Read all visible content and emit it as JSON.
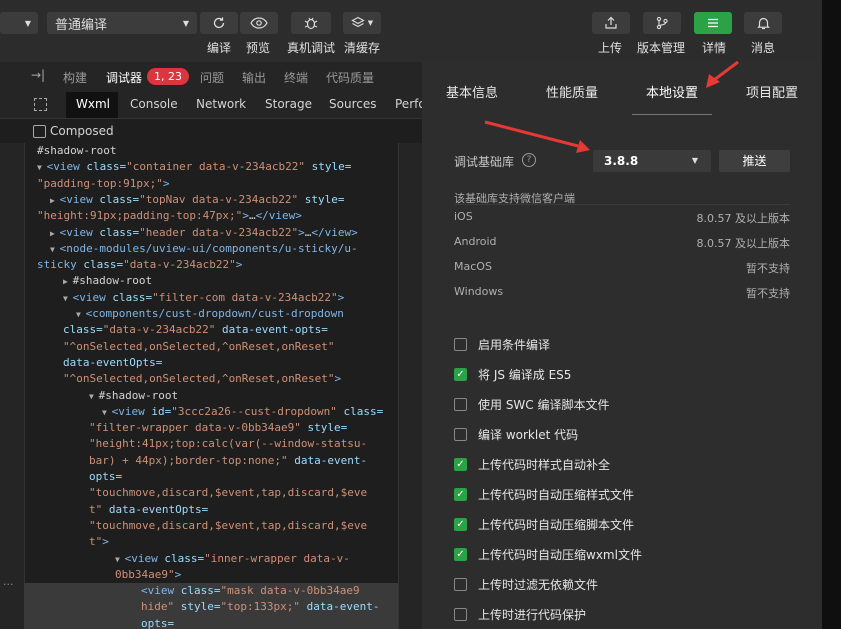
{
  "toolbar": {
    "compile_mode": "普通编译",
    "left_buttons": [
      "编译",
      "预览",
      "真机调试",
      "清缓存"
    ],
    "right_buttons": [
      "上传",
      "版本管理",
      "详情",
      "消息"
    ],
    "accent": "#2ba245"
  },
  "devtools": {
    "top_tabs": [
      "构建",
      "调试器",
      "问题",
      "输出",
      "终端",
      "代码质量"
    ],
    "badge": "1, 23",
    "sub_tabs": [
      "Wxml",
      "Console",
      "Network",
      "Storage",
      "Sources",
      "Perfo"
    ],
    "composed_label": "Composed",
    "dots": "···",
    "code_lines": [
      {
        "indent": 2,
        "tri": "",
        "parts": [
          [
            "tx",
            "#shadow-root"
          ]
        ]
      },
      {
        "indent": 2,
        "tri": "▼",
        "parts": [
          [
            "tg",
            "<view "
          ],
          [
            "at",
            "class="
          ],
          [
            "vl",
            "\"container data-v-234acb22\""
          ],
          [
            "at",
            " style="
          ]
        ]
      },
      {
        "indent": 2,
        "tri": "",
        "parts": [
          [
            "vl",
            "\"padding-top:91px;\""
          ],
          [
            "tg",
            ">"
          ]
        ]
      },
      {
        "indent": 3,
        "tri": "▶",
        "parts": [
          [
            "tg",
            "<view "
          ],
          [
            "at",
            "class="
          ],
          [
            "vl",
            "\"topNav data-v-234acb22\""
          ],
          [
            "at",
            " style="
          ]
        ]
      },
      {
        "indent": 2,
        "tri": "",
        "parts": [
          [
            "vl",
            "\"height:91px;padding-top:47px;\""
          ],
          [
            "tg",
            ">"
          ],
          [
            "tx",
            "…"
          ],
          [
            "tg",
            "</view>"
          ]
        ]
      },
      {
        "indent": 3,
        "tri": "▶",
        "parts": [
          [
            "tg",
            "<view "
          ],
          [
            "at",
            "class="
          ],
          [
            "vl",
            "\"header data-v-234acb22\""
          ],
          [
            "tg",
            ">"
          ],
          [
            "tx",
            "…"
          ],
          [
            "tg",
            "</view>"
          ]
        ]
      },
      {
        "indent": 3,
        "tri": "▼",
        "parts": [
          [
            "tg",
            "<node-modules/uview-ui/components/u-sticky/u-"
          ]
        ]
      },
      {
        "indent": 2,
        "tri": "",
        "parts": [
          [
            "tg",
            "sticky "
          ],
          [
            "at",
            "class="
          ],
          [
            "vl",
            "\"data-v-234acb22\""
          ],
          [
            "tg",
            ">"
          ]
        ]
      },
      {
        "indent": 4,
        "tri": "▶",
        "parts": [
          [
            "tx",
            "#shadow-root"
          ]
        ]
      },
      {
        "indent": 4,
        "tri": "▼",
        "parts": [
          [
            "tg",
            "<view "
          ],
          [
            "at",
            "class="
          ],
          [
            "vl",
            "\"filter-com data-v-234acb22\""
          ],
          [
            "tg",
            ">"
          ]
        ]
      },
      {
        "indent": 5,
        "tri": "▼",
        "parts": [
          [
            "tg",
            "<components/cust-dropdown/cust-dropdown"
          ]
        ]
      },
      {
        "indent": 4,
        "tri": "",
        "parts": [
          [
            "at",
            "class="
          ],
          [
            "vl",
            "\"data-v-234acb22\""
          ],
          [
            "at",
            " data-event-opts="
          ]
        ]
      },
      {
        "indent": 4,
        "tri": "",
        "parts": [
          [
            "vl",
            "\"^onSelected,onSelected,^onReset,onReset\""
          ]
        ]
      },
      {
        "indent": 4,
        "tri": "",
        "parts": [
          [
            "at",
            "data-eventOpts="
          ]
        ]
      },
      {
        "indent": 4,
        "tri": "",
        "parts": [
          [
            "vl",
            "\"^onSelected,onSelected,^onReset,onReset\""
          ],
          [
            "tg",
            ">"
          ]
        ]
      },
      {
        "indent": 6,
        "tri": "▼",
        "parts": [
          [
            "tx",
            "#shadow-root"
          ]
        ]
      },
      {
        "indent": 7,
        "tri": "▼",
        "parts": [
          [
            "tg",
            "<view "
          ],
          [
            "at",
            "id="
          ],
          [
            "vl",
            "\"3ccc2a26--cust-dropdown\""
          ],
          [
            "at",
            " class="
          ]
        ]
      },
      {
        "indent": 6,
        "tri": "",
        "parts": [
          [
            "vl",
            "\"filter-wrapper data-v-0bb34ae9\""
          ],
          [
            "at",
            " style="
          ]
        ]
      },
      {
        "indent": 6,
        "tri": "",
        "parts": [
          [
            "vl",
            "\"height:41px;top:calc(var(--window-statsu-"
          ]
        ]
      },
      {
        "indent": 6,
        "tri": "",
        "parts": [
          [
            "vl",
            "bar) + 44px);border-top:none;\""
          ],
          [
            "at",
            " data-event-"
          ]
        ]
      },
      {
        "indent": 6,
        "tri": "",
        "parts": [
          [
            "at",
            "opts="
          ]
        ]
      },
      {
        "indent": 6,
        "tri": "",
        "parts": [
          [
            "vl",
            "\"touchmove,discard,$event,tap,discard,$eve"
          ]
        ]
      },
      {
        "indent": 6,
        "tri": "",
        "parts": [
          [
            "vl",
            "t\""
          ],
          [
            "at",
            " data-eventOpts="
          ]
        ]
      },
      {
        "indent": 6,
        "tri": "",
        "parts": [
          [
            "vl",
            "\"touchmove,discard,$event,tap,discard,$eve"
          ]
        ]
      },
      {
        "indent": 6,
        "tri": "",
        "parts": [
          [
            "vl",
            "t\""
          ],
          [
            "tg",
            ">"
          ]
        ]
      },
      {
        "indent": 8,
        "tri": "▼",
        "parts": [
          [
            "tg",
            "<view "
          ],
          [
            "at",
            "class="
          ],
          [
            "vl",
            "\"inner-wrapper data-v-"
          ]
        ]
      },
      {
        "indent": 8,
        "tri": "",
        "parts": [
          [
            "vl",
            "0bb34ae9\""
          ],
          [
            "tg",
            ">"
          ]
        ]
      },
      {
        "indent": 10,
        "tri": "",
        "parts": [
          [
            "tg",
            "<view "
          ],
          [
            "at",
            "class="
          ],
          [
            "vl",
            "\"mask data-v-0bb34ae9"
          ]
        ]
      },
      {
        "indent": 10,
        "tri": "",
        "parts": [
          [
            "vl",
            "hide\""
          ],
          [
            "at",
            " style="
          ],
          [
            "vl",
            "\"top:133px;\""
          ],
          [
            "at",
            " data-event-"
          ]
        ]
      },
      {
        "indent": 10,
        "tri": "",
        "parts": [
          [
            "at",
            "opts="
          ]
        ]
      }
    ]
  },
  "settings": {
    "tabs": [
      "基本信息",
      "性能质量",
      "本地设置",
      "项目配置"
    ],
    "active_tab": "本地设置",
    "base_lib_label": "调试基础库",
    "base_lib_version": "3.8.8",
    "push_button": "推送",
    "support_title": "该基础库支持微信客户端",
    "support_rows": [
      {
        "platform": "iOS",
        "value": "8.0.57 及以上版本"
      },
      {
        "platform": "Android",
        "value": "8.0.57 及以上版本"
      },
      {
        "platform": "MacOS",
        "value": "暂不支持"
      },
      {
        "platform": "Windows",
        "value": "暂不支持"
      }
    ],
    "options": [
      {
        "label": "启用条件编译",
        "checked": false
      },
      {
        "label": "将 JS 编译成 ES5",
        "checked": true
      },
      {
        "label": "使用 SWC 编译脚本文件",
        "checked": false
      },
      {
        "label": "编译 worklet 代码",
        "checked": false
      },
      {
        "label": "上传代码时样式自动补全",
        "checked": true
      },
      {
        "label": "上传代码时自动压缩样式文件",
        "checked": true
      },
      {
        "label": "上传代码时自动压缩脚本文件",
        "checked": true
      },
      {
        "label": "上传代码时自动压缩wxml文件",
        "checked": true
      },
      {
        "label": "上传时过滤无依赖文件",
        "checked": false
      },
      {
        "label": "上传时进行代码保护",
        "checked": false
      }
    ],
    "arrow_color": "#e53935"
  }
}
